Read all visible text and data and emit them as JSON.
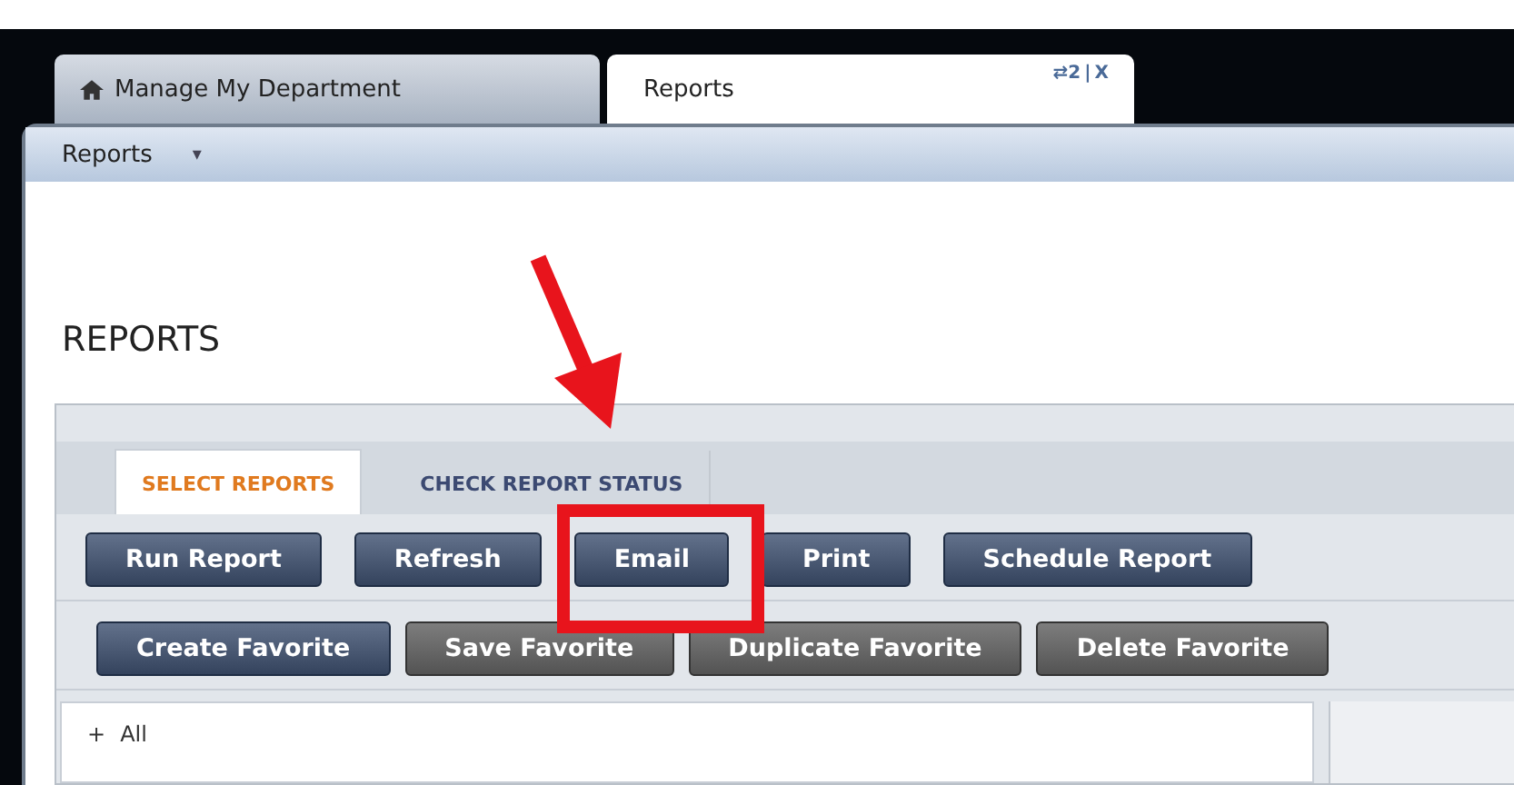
{
  "tabs": [
    {
      "label": "Manage My Department",
      "selected": false
    },
    {
      "label": "Reports",
      "selected": true,
      "controls": [
        "⇄2",
        "|",
        "X"
      ]
    }
  ],
  "toolbar": {
    "menu": "Reports",
    "caret": "▾"
  },
  "page_title": "REPORTS",
  "subtabs": [
    {
      "label": "SELECT REPORTS",
      "selected": true
    },
    {
      "label": "CHECK REPORT STATUS",
      "selected": false
    }
  ],
  "button_rows": [
    [
      {
        "label": "Run Report",
        "disabled": false
      },
      {
        "label": "Refresh",
        "disabled": false
      },
      {
        "label": "Email",
        "disabled": false
      },
      {
        "label": "Print",
        "disabled": false
      },
      {
        "label": "Schedule Report",
        "disabled": false
      }
    ],
    [
      {
        "label": "Create Favorite",
        "disabled": false
      },
      {
        "label": "Save Favorite",
        "disabled": true
      },
      {
        "label": "Duplicate Favorite",
        "disabled": true
      },
      {
        "label": "Delete Favorite",
        "disabled": true
      }
    ]
  ],
  "tree": [
    {
      "label": "All",
      "toggle": "+"
    }
  ]
}
